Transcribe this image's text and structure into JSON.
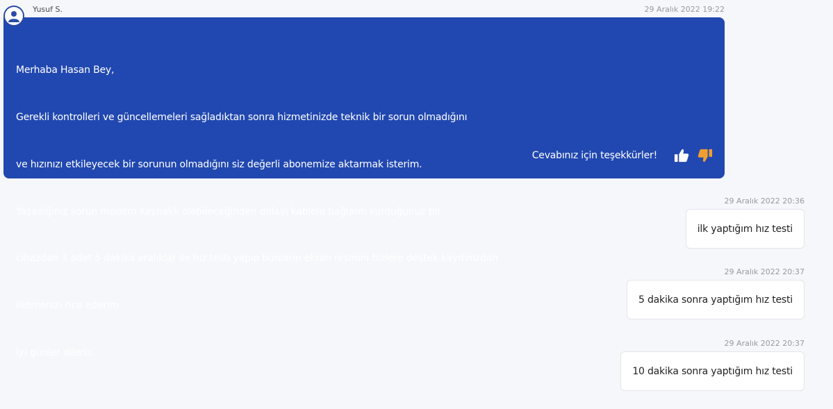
{
  "agent_message": {
    "author": "Yusuf S.",
    "timestamp": "29 Aralık 2022 19:22",
    "lines": [
      "Merhaba Hasan Bey,",
      "Gerekli kontrolleri ve güncellemeleri sağladıktan sonra hizmetinizde teknik bir sorun olmadığını",
      "ve hızınızı etkileyecek bir sorunun olmadığını siz değerli abonemize aktarmak isterim.",
      "Yaşadığınız sorun modem kaynaklı olabileceğinden dolayı kablolu bağlantı kurduğunuz bir",
      "cihazdan 3 adet 5 dakika aralıklar ile hız testi yapıp bunların ekran resmini bizlere destek kaydınızdan",
      "iletmenizi rica ederim.",
      "İyi günler dileriz."
    ],
    "feedback_label": "Cevabınız için teşekkürler!",
    "like_icon": "thumbs-up-icon",
    "dislike_icon": "thumbs-down-icon",
    "colors": {
      "bubble": "#2148b0",
      "like": "#ffffff",
      "dislike": "#f0a030"
    }
  },
  "user_messages": [
    {
      "timestamp": "29 Aralık 2022 20:36",
      "text": "ilk yaptığım hız testi"
    },
    {
      "timestamp": "29 Aralık 2022 20:37",
      "text": "5 dakika sonra yaptığım hız testi"
    },
    {
      "timestamp": "29 Aralık 2022 20:37",
      "text": "10 dakika sonra yaptığım hız testi"
    }
  ]
}
